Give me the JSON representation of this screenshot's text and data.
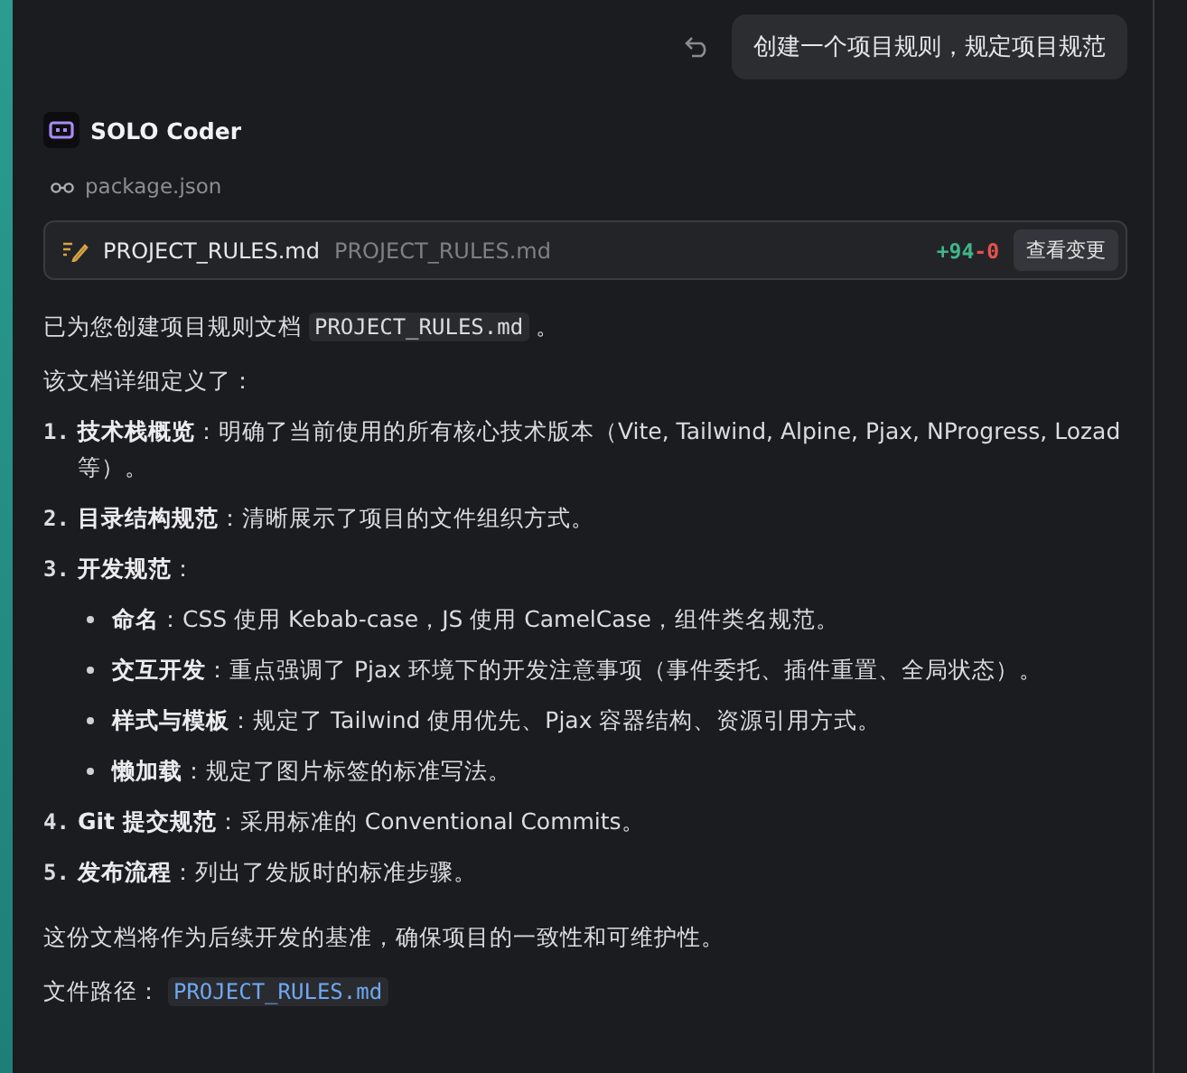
{
  "user_message": {
    "text": "创建一个项目规则，规定项目规范"
  },
  "agent": {
    "name": "SOLO Coder"
  },
  "read_file": {
    "name": "package.json"
  },
  "file_change": {
    "name": "PROJECT_RULES.md",
    "path": "PROJECT_RULES.md",
    "added": "+94",
    "removed": "-0",
    "button": "查看变更"
  },
  "intro": [
    {
      "text": "已为您创建项目规则文档 "
    },
    {
      "code": "PROJECT_RULES.md"
    },
    {
      "text": " 。"
    }
  ],
  "lead": "该文档详细定义了：",
  "list": [
    {
      "number": "1.",
      "label": "技术栈概览",
      "text": "：明确了当前使用的所有核心技术版本（Vite, Tailwind, Alpine, Pjax, NProgress, Lozad 等）。"
    },
    {
      "number": "2.",
      "label": "目录结构规范",
      "text": "：清晰展示了项目的文件组织方式。"
    },
    {
      "number": "3.",
      "label": "开发规范",
      "text": "：",
      "children": [
        {
          "label": "命名",
          "text": "：CSS 使用 Kebab-case，JS 使用 CamelCase，组件类名规范。"
        },
        {
          "label": "交互开发",
          "text": "：重点强调了 Pjax 环境下的开发注意事项（事件委托、插件重置、全局状态）。"
        },
        {
          "label": "样式与模板",
          "text": "：规定了 Tailwind 使用优先、Pjax 容器结构、资源引用方式。"
        },
        {
          "label": "懒加载",
          "text": "：规定了图片标签的标准写法。"
        }
      ]
    },
    {
      "number": "4.",
      "label": "Git 提交规范",
      "text": "：采用标准的 Conventional Commits。"
    },
    {
      "number": "5.",
      "label": "发布流程",
      "text": "：列出了发版时的标准步骤。"
    }
  ],
  "closing": "这份文档将作为后续开发的基准，确保项目的一致性和可维护性。",
  "file_path": {
    "label": "文件路径：",
    "link": "PROJECT_RULES.md"
  }
}
